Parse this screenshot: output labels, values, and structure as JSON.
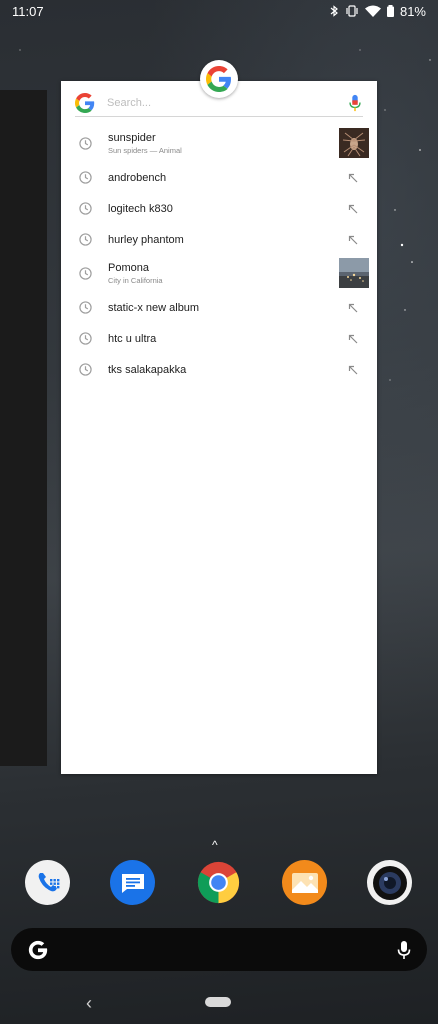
{
  "status_bar": {
    "time": "11:07",
    "battery_percent": "81%",
    "icons": [
      "bluetooth-icon",
      "vibrate-icon",
      "wifi-icon",
      "battery-icon"
    ]
  },
  "search_panel": {
    "placeholder": "Search...",
    "suggestions": [
      {
        "title": "sunspider",
        "subtitle": "Sun spiders — Animal",
        "has_thumbnail": true
      },
      {
        "title": "androbench",
        "subtitle": "",
        "has_thumbnail": false
      },
      {
        "title": "logitech k830",
        "subtitle": "",
        "has_thumbnail": false
      },
      {
        "title": "hurley phantom",
        "subtitle": "",
        "has_thumbnail": false
      },
      {
        "title": "Pomona",
        "subtitle": "City in California",
        "has_thumbnail": true
      },
      {
        "title": "static-x new album",
        "subtitle": "",
        "has_thumbnail": false
      },
      {
        "title": "htc u ultra",
        "subtitle": "",
        "has_thumbnail": false
      },
      {
        "title": "tks salakapakka",
        "subtitle": "",
        "has_thumbnail": false
      }
    ]
  },
  "dock": {
    "apps": [
      "phone-icon",
      "messages-icon",
      "chrome-icon",
      "gallery-icon",
      "camera-icon"
    ]
  },
  "colors": {
    "google_blue": "#4285F4",
    "google_red": "#EA4335",
    "google_yellow": "#FBBC05",
    "google_green": "#34A853"
  }
}
